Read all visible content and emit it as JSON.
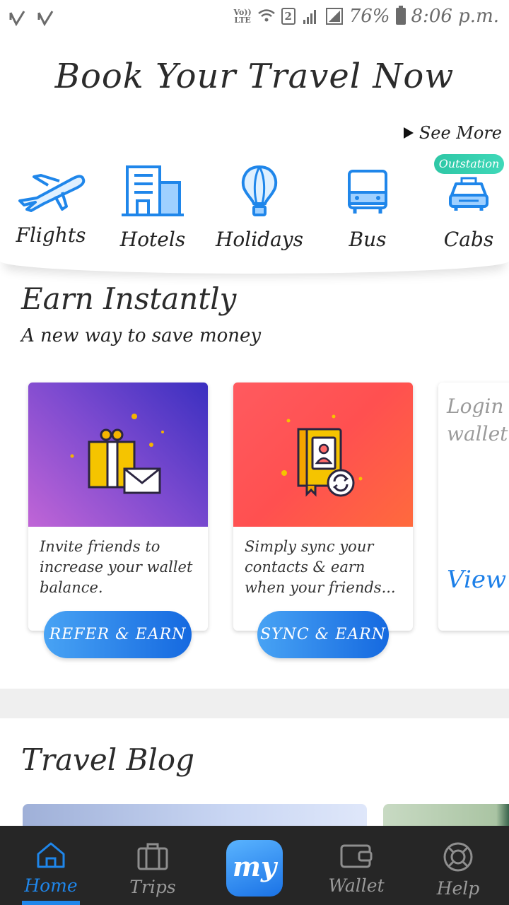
{
  "status_bar": {
    "volte": "Vo))\nLTE",
    "sim": "2",
    "battery": "76%",
    "time": "8:06 p.m."
  },
  "header": {
    "title": "Book Your Travel Now",
    "see_more": "See More"
  },
  "categories": [
    {
      "label": "Flights",
      "icon": "airplane-icon"
    },
    {
      "label": "Hotels",
      "icon": "building-icon"
    },
    {
      "label": "Holidays",
      "icon": "hot-air-balloon-icon"
    },
    {
      "label": "Bus",
      "icon": "bus-icon"
    },
    {
      "label": "Cabs",
      "icon": "taxi-icon",
      "badge": "Outstation"
    }
  ],
  "earn": {
    "title": "Earn Instantly",
    "subtitle": "A new way to save money",
    "cards": [
      {
        "text": "Invite friends to increase your wallet balance.",
        "button": "REFER & EARN",
        "icon": "gift-envelope-icon"
      },
      {
        "text": "Simply sync your contacts & earn when your friends...",
        "button": "SYNC & EARN",
        "icon": "contact-book-sync-icon"
      },
      {
        "text": "Login to view your wallet balance",
        "link": "View Wallet"
      }
    ]
  },
  "blog": {
    "title": "Travel Blog"
  },
  "bottom_nav": {
    "items": [
      {
        "label": "Home",
        "icon": "home-icon",
        "active": true
      },
      {
        "label": "Trips",
        "icon": "briefcase-icon"
      },
      {
        "label": "my",
        "icon": "mmt-logo"
      },
      {
        "label": "Wallet",
        "icon": "wallet-icon"
      },
      {
        "label": "Help",
        "icon": "lifebuoy-icon"
      }
    ]
  },
  "colors": {
    "accent": "#1f86ea",
    "badge": "#2ec7a6",
    "card1_gradient": [
      "#c065d6",
      "#3a2fc0"
    ],
    "card2_gradient": [
      "#ff5a5f",
      "#ff6a3d"
    ],
    "nav_bg": "#262626"
  }
}
